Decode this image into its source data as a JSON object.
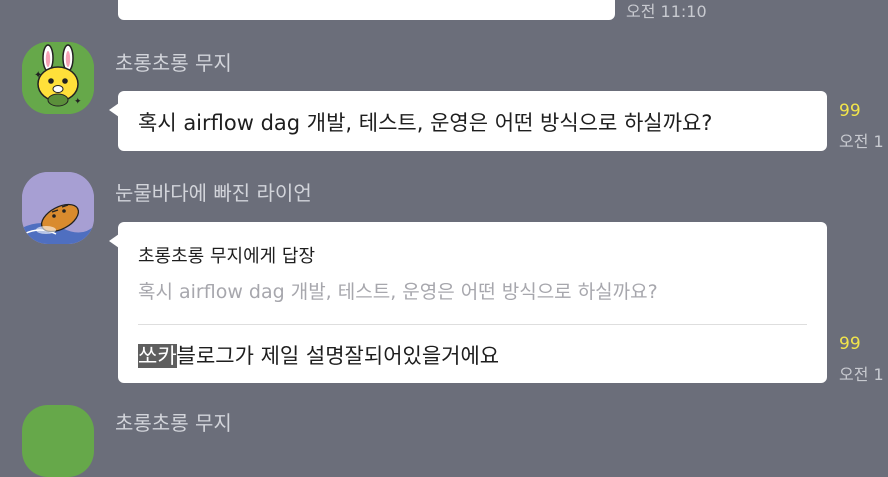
{
  "messages": [
    {
      "kind": "partial_bubble",
      "time": "오전 11:10"
    },
    {
      "sender": "초롱초롱 무지",
      "text": "혹시 airflow dag 개발, 테스트, 운영은 어떤 방식으로 하실까요?",
      "unread_count": "99",
      "time": "오전 1"
    },
    {
      "sender": "눈물바다에 빠진 라이언",
      "reply_to": "초롱초롱 무지에게 답장",
      "quoted_text": "혹시 airflow dag 개발, 테스트, 운영은 어떤 방식으로 하실까요?",
      "text_highlight": "쏘카",
      "text_rest": "블로그가 제일 설명잘되어있을거에요",
      "unread_count": "99",
      "time": "오전 1"
    },
    {
      "sender": "초롱초롱 무지",
      "kind": "partial_next"
    }
  ],
  "colors": {
    "background": "#6b6e7a",
    "bubble": "#ffffff",
    "unread": "#f2e54b",
    "highlight": "#5e5e5e"
  },
  "icons": {
    "muzi_avatar": "muzi-rabbit-avatar",
    "ryan_avatar": "ryan-lion-avatar"
  }
}
